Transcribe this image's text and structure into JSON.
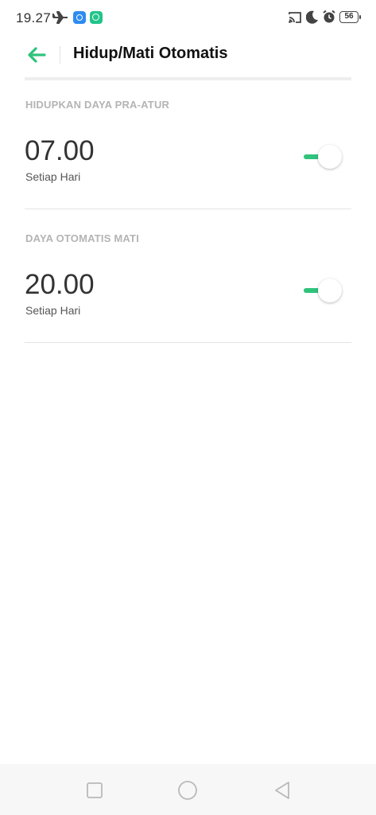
{
  "status_bar": {
    "time": "19.27",
    "battery": "56",
    "icons": [
      "airplane-icon",
      "app-icon-blue",
      "app-icon-green",
      "cast-icon",
      "moon-icon",
      "alarm-icon",
      "battery-icon"
    ]
  },
  "header": {
    "title": "Hidup/Mati Otomatis",
    "back_icon": "arrow-left-icon",
    "accent_color": "#2fc37b"
  },
  "sections": [
    {
      "title": "HIDUPKAN DAYA PRA-ATUR",
      "time": "07.00",
      "repeat": "Setiap Hari",
      "enabled": true
    },
    {
      "title": "DAYA OTOMATIS MATI",
      "time": "20.00",
      "repeat": "Setiap Hari",
      "enabled": true
    }
  ],
  "nav_bar": {
    "buttons": [
      "recents-square-icon",
      "home-circle-icon",
      "back-triangle-icon"
    ]
  }
}
